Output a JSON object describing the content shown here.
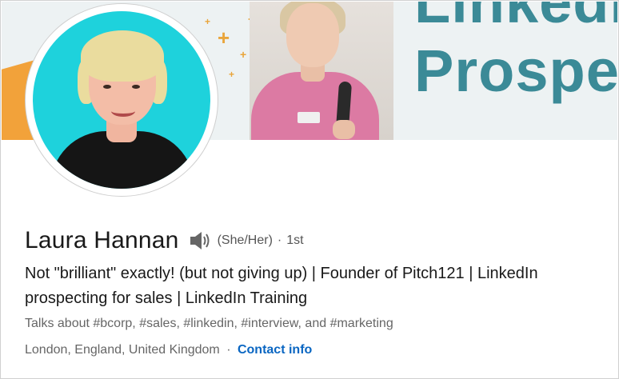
{
  "banner": {
    "line1": "LinkedIn",
    "line2": "Prospec",
    "colors": {
      "teal": "#3b8a97",
      "orange": "#f2a23a",
      "sparkle": "#e9a53b"
    }
  },
  "profile": {
    "name": "Laura Hannan",
    "name_pronunciation_icon": "speaker-icon",
    "pronouns": "(She/Her)",
    "separator": "·",
    "connection_degree": "1st",
    "headline": "Not \"brilliant\" exactly! (but not giving up) | Founder of Pitch121 | LinkedIn prospecting for sales | LinkedIn Training",
    "talks_about": "Talks about #bcorp, #sales, #linkedin, #interview, and #marketing",
    "location": "London, England, United Kingdom",
    "location_separator": "·",
    "contact_info_label": "Contact info"
  },
  "colors": {
    "link": "#0a66c2",
    "avatar_bg": "#1ed2dc"
  }
}
